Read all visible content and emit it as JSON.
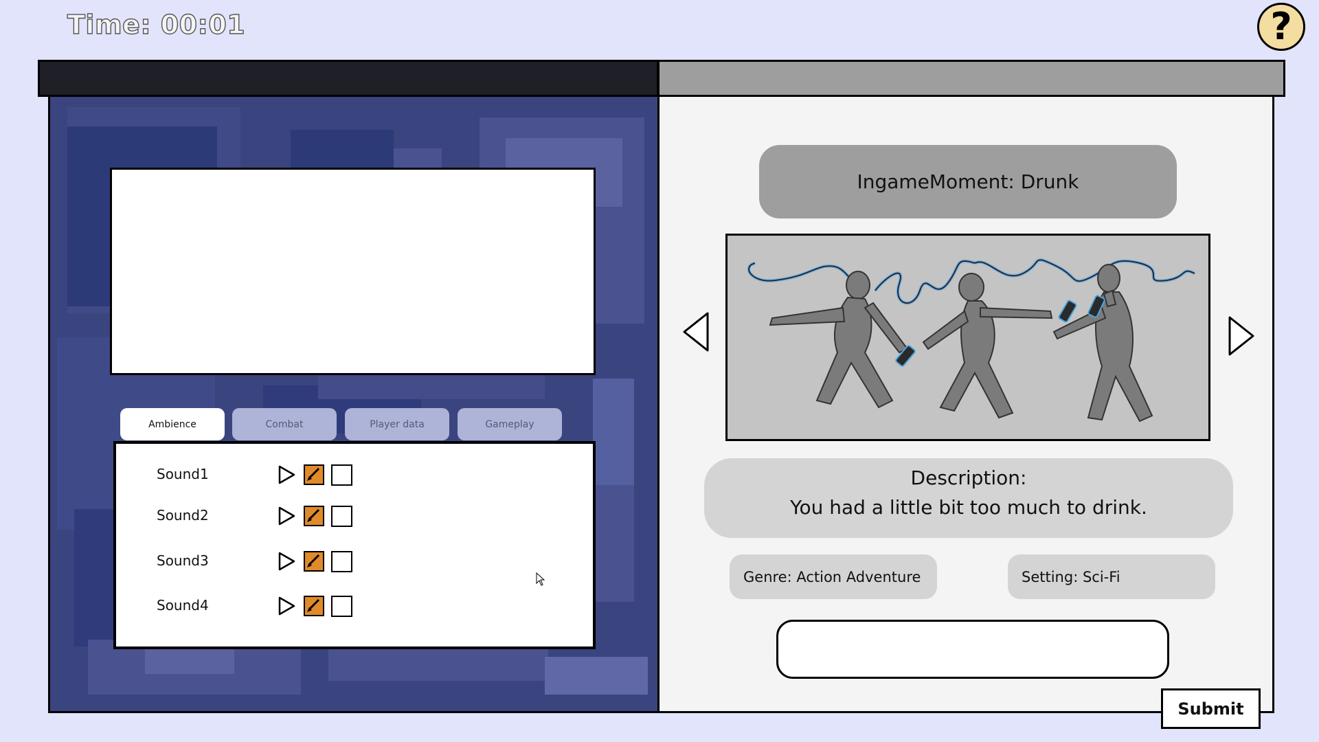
{
  "hud": {
    "timer": "Time: 00:01",
    "help_label": "?"
  },
  "tabs": [
    {
      "label": "Ambience",
      "active": true
    },
    {
      "label": "Combat",
      "active": false
    },
    {
      "label": "Player data",
      "active": false
    },
    {
      "label": "Gameplay",
      "active": false
    }
  ],
  "sounds": [
    {
      "name": "Sound1",
      "checked": false
    },
    {
      "name": "Sound2",
      "checked": false
    },
    {
      "name": "Sound3",
      "checked": false
    },
    {
      "name": "Sound4",
      "checked": false
    }
  ],
  "moment": {
    "title": "IngameMoment: Drunk",
    "description_title": "Description:",
    "description_text": "You had a little bit too much to drink.",
    "genre": "Genre: Action Adventure",
    "setting": "Setting: Sci-Fi"
  },
  "answer": {
    "value": "",
    "placeholder": ""
  },
  "submit_label": "Submit",
  "colors": {
    "background": "#e1e4fb",
    "left_panel": "#3a447e",
    "accent_edit": "#e08a2a",
    "title_pill": "#9e9e9e",
    "info_pill": "#d4d4d4",
    "help_button": "#f3dda0"
  },
  "icons": {
    "help": "question-mark-icon",
    "play": "play-icon",
    "edit": "brush-icon",
    "check": "checkbox-icon",
    "prev": "chevron-left-icon",
    "next": "chevron-right-icon"
  }
}
